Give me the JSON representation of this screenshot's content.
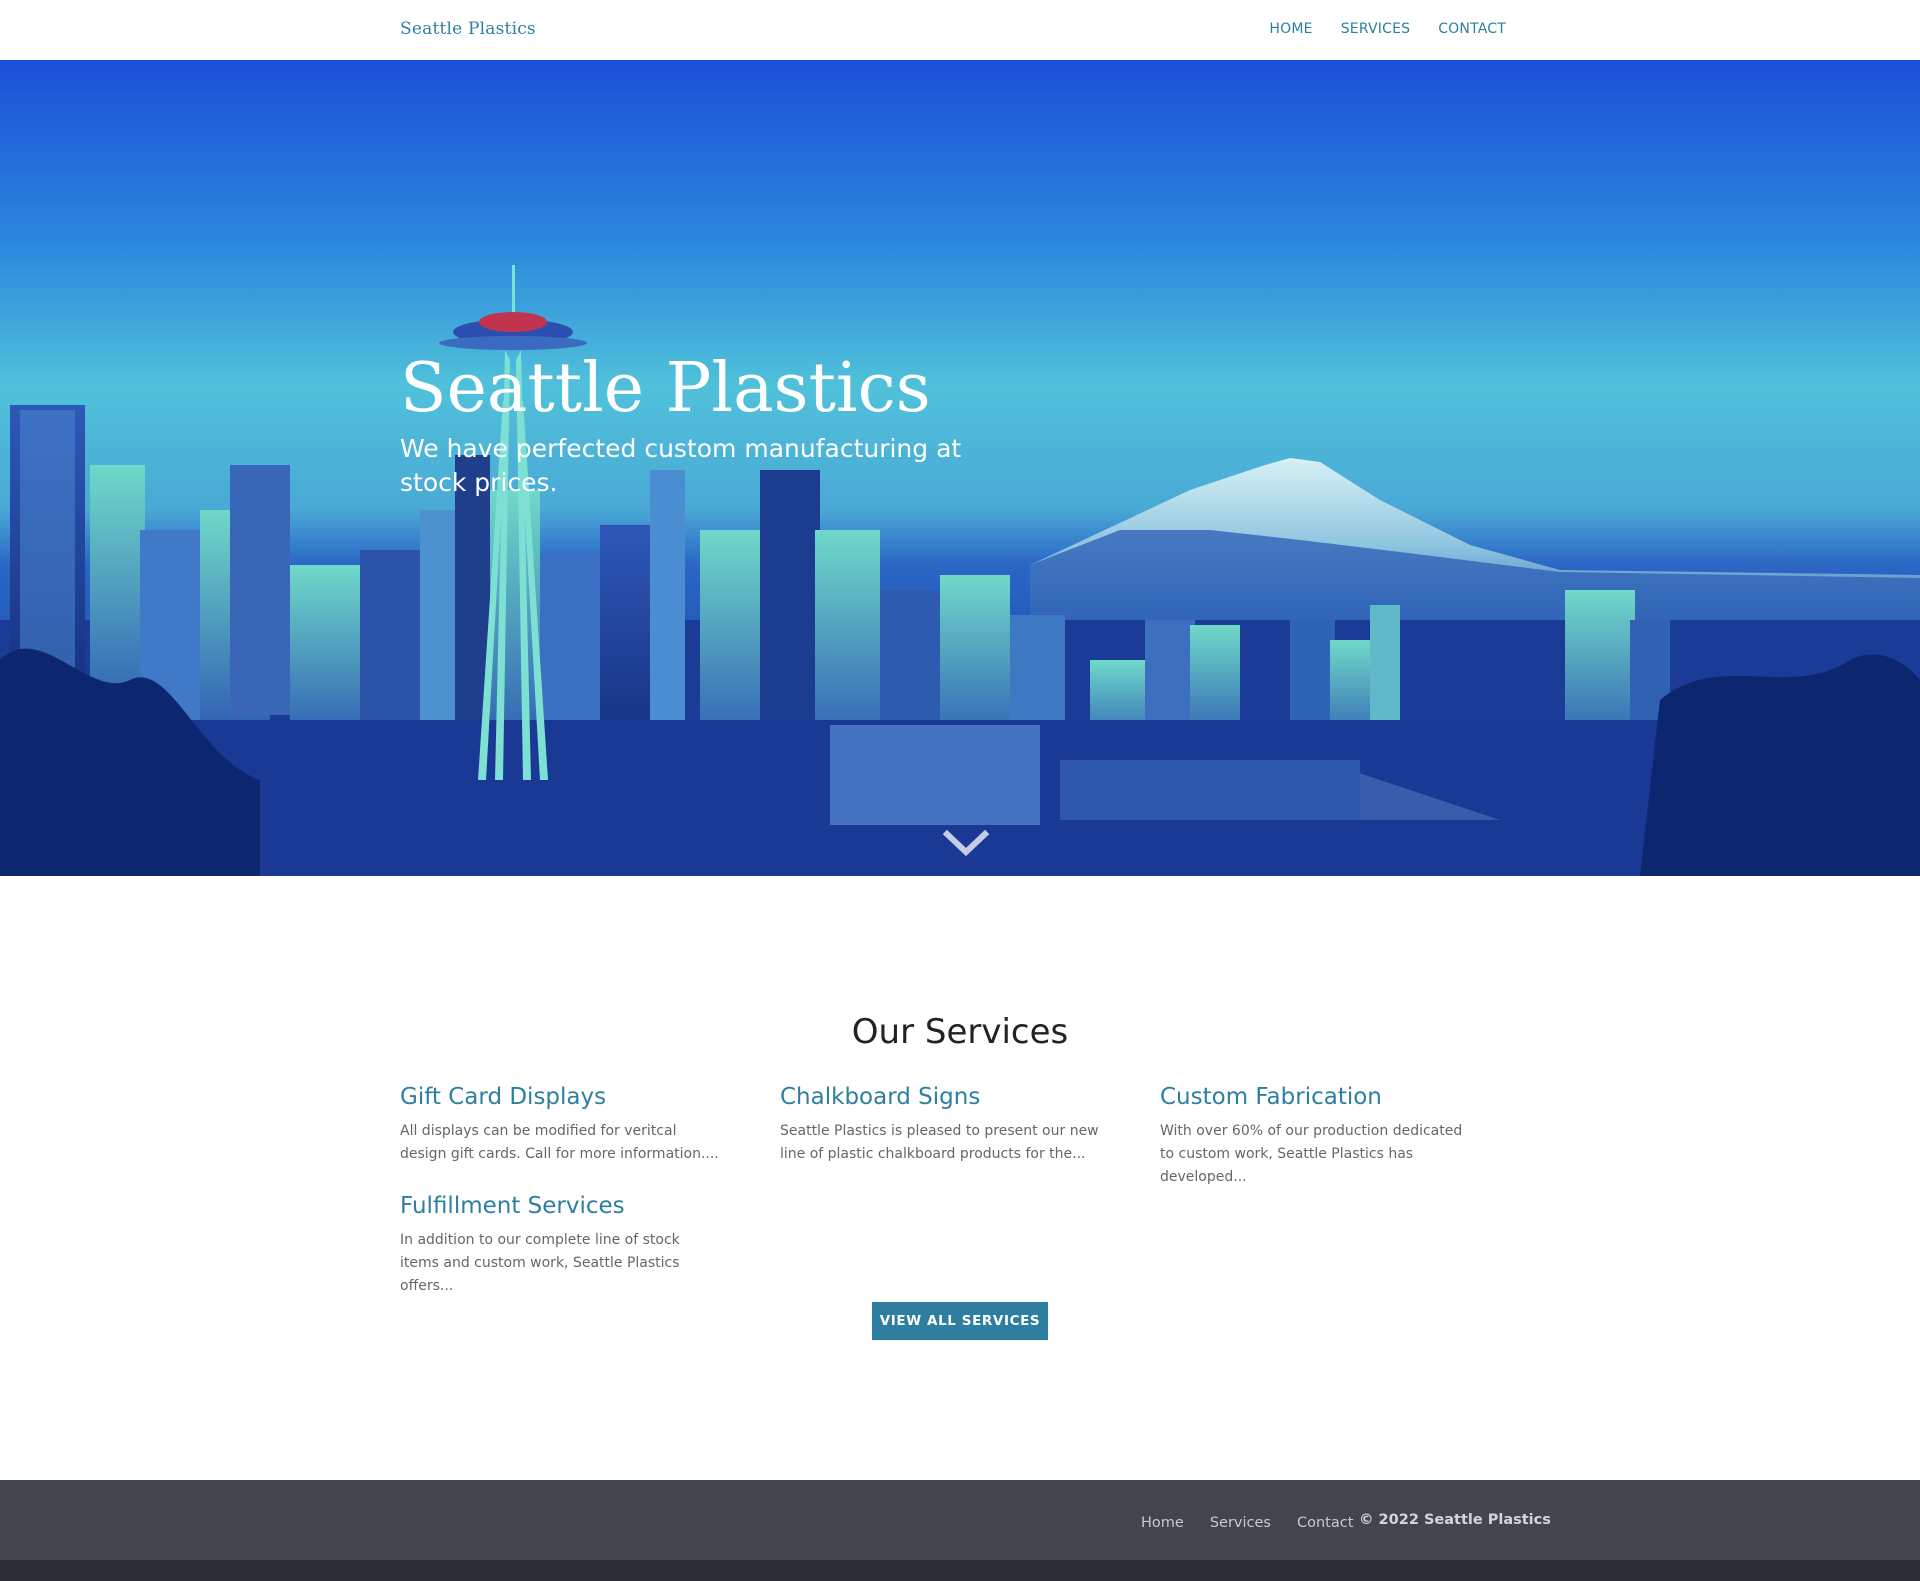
{
  "navbar": {
    "brand": "Seattle Plastics",
    "links": [
      {
        "label": "HOME"
      },
      {
        "label": "SERVICES"
      },
      {
        "label": "CONTACT"
      }
    ]
  },
  "hero": {
    "title": "Seattle Plastics",
    "subtitle": "We have perfected custom manufacturing at stock prices.",
    "scroll_icon": "chevron-down-icon"
  },
  "services": {
    "heading": "Our Services",
    "items": [
      {
        "title": "Gift Card Displays",
        "description": "All displays can be modified for veritcal design gift cards. Call for more information...."
      },
      {
        "title": "Chalkboard Signs",
        "description": "Seattle Plastics is pleased to present our new line of plastic chalkboard products for the..."
      },
      {
        "title": "Custom Fabrication",
        "description": "With over 60% of our production dedicated to custom work, Seattle Plastics has developed..."
      },
      {
        "title": "Fulfillment Services",
        "description": "In addition to our complete line of stock items and custom work, Seattle Plastics offers..."
      }
    ],
    "view_all_label": "VIEW ALL SERVICES"
  },
  "footer": {
    "links": [
      {
        "label": "Home"
      },
      {
        "label": "Services"
      },
      {
        "label": "Contact"
      }
    ],
    "copyright": "© 2022 Seattle Plastics"
  },
  "colors": {
    "accent": "#2e7f9f",
    "hero_sky_top": "#1f4fd6",
    "hero_sky_mid": "#4fbfd8",
    "footer": "#43454c",
    "footer_bottom": "#2b2d33"
  }
}
